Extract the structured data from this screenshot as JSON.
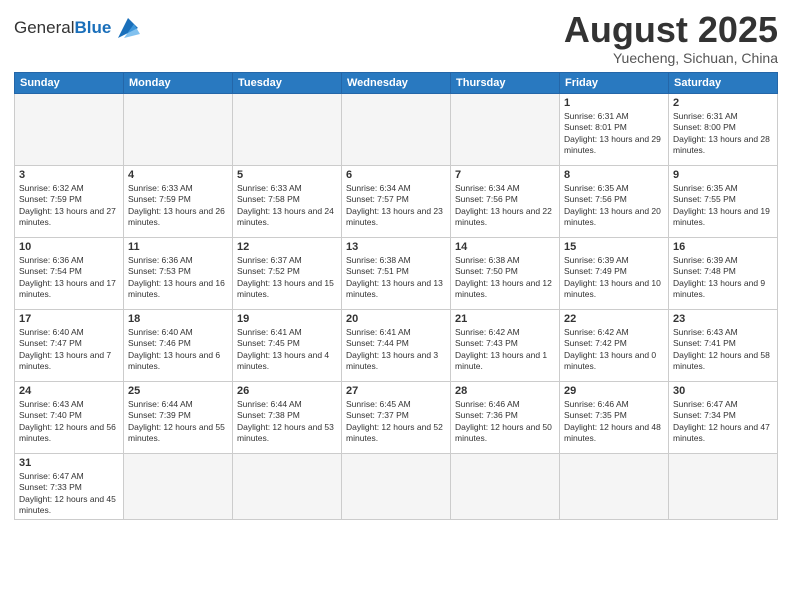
{
  "header": {
    "logo_general": "General",
    "logo_blue": "Blue",
    "month_title": "August 2025",
    "subtitle": "Yuecheng, Sichuan, China"
  },
  "weekdays": [
    "Sunday",
    "Monday",
    "Tuesday",
    "Wednesday",
    "Thursday",
    "Friday",
    "Saturday"
  ],
  "weeks": [
    [
      {
        "day": "",
        "info": ""
      },
      {
        "day": "",
        "info": ""
      },
      {
        "day": "",
        "info": ""
      },
      {
        "day": "",
        "info": ""
      },
      {
        "day": "",
        "info": ""
      },
      {
        "day": "1",
        "info": "Sunrise: 6:31 AM\nSunset: 8:01 PM\nDaylight: 13 hours and 29 minutes."
      },
      {
        "day": "2",
        "info": "Sunrise: 6:31 AM\nSunset: 8:00 PM\nDaylight: 13 hours and 28 minutes."
      }
    ],
    [
      {
        "day": "3",
        "info": "Sunrise: 6:32 AM\nSunset: 7:59 PM\nDaylight: 13 hours and 27 minutes."
      },
      {
        "day": "4",
        "info": "Sunrise: 6:33 AM\nSunset: 7:59 PM\nDaylight: 13 hours and 26 minutes."
      },
      {
        "day": "5",
        "info": "Sunrise: 6:33 AM\nSunset: 7:58 PM\nDaylight: 13 hours and 24 minutes."
      },
      {
        "day": "6",
        "info": "Sunrise: 6:34 AM\nSunset: 7:57 PM\nDaylight: 13 hours and 23 minutes."
      },
      {
        "day": "7",
        "info": "Sunrise: 6:34 AM\nSunset: 7:56 PM\nDaylight: 13 hours and 22 minutes."
      },
      {
        "day": "8",
        "info": "Sunrise: 6:35 AM\nSunset: 7:56 PM\nDaylight: 13 hours and 20 minutes."
      },
      {
        "day": "9",
        "info": "Sunrise: 6:35 AM\nSunset: 7:55 PM\nDaylight: 13 hours and 19 minutes."
      }
    ],
    [
      {
        "day": "10",
        "info": "Sunrise: 6:36 AM\nSunset: 7:54 PM\nDaylight: 13 hours and 17 minutes."
      },
      {
        "day": "11",
        "info": "Sunrise: 6:36 AM\nSunset: 7:53 PM\nDaylight: 13 hours and 16 minutes."
      },
      {
        "day": "12",
        "info": "Sunrise: 6:37 AM\nSunset: 7:52 PM\nDaylight: 13 hours and 15 minutes."
      },
      {
        "day": "13",
        "info": "Sunrise: 6:38 AM\nSunset: 7:51 PM\nDaylight: 13 hours and 13 minutes."
      },
      {
        "day": "14",
        "info": "Sunrise: 6:38 AM\nSunset: 7:50 PM\nDaylight: 13 hours and 12 minutes."
      },
      {
        "day": "15",
        "info": "Sunrise: 6:39 AM\nSunset: 7:49 PM\nDaylight: 13 hours and 10 minutes."
      },
      {
        "day": "16",
        "info": "Sunrise: 6:39 AM\nSunset: 7:48 PM\nDaylight: 13 hours and 9 minutes."
      }
    ],
    [
      {
        "day": "17",
        "info": "Sunrise: 6:40 AM\nSunset: 7:47 PM\nDaylight: 13 hours and 7 minutes."
      },
      {
        "day": "18",
        "info": "Sunrise: 6:40 AM\nSunset: 7:46 PM\nDaylight: 13 hours and 6 minutes."
      },
      {
        "day": "19",
        "info": "Sunrise: 6:41 AM\nSunset: 7:45 PM\nDaylight: 13 hours and 4 minutes."
      },
      {
        "day": "20",
        "info": "Sunrise: 6:41 AM\nSunset: 7:44 PM\nDaylight: 13 hours and 3 minutes."
      },
      {
        "day": "21",
        "info": "Sunrise: 6:42 AM\nSunset: 7:43 PM\nDaylight: 13 hours and 1 minute."
      },
      {
        "day": "22",
        "info": "Sunrise: 6:42 AM\nSunset: 7:42 PM\nDaylight: 13 hours and 0 minutes."
      },
      {
        "day": "23",
        "info": "Sunrise: 6:43 AM\nSunset: 7:41 PM\nDaylight: 12 hours and 58 minutes."
      }
    ],
    [
      {
        "day": "24",
        "info": "Sunrise: 6:43 AM\nSunset: 7:40 PM\nDaylight: 12 hours and 56 minutes."
      },
      {
        "day": "25",
        "info": "Sunrise: 6:44 AM\nSunset: 7:39 PM\nDaylight: 12 hours and 55 minutes."
      },
      {
        "day": "26",
        "info": "Sunrise: 6:44 AM\nSunset: 7:38 PM\nDaylight: 12 hours and 53 minutes."
      },
      {
        "day": "27",
        "info": "Sunrise: 6:45 AM\nSunset: 7:37 PM\nDaylight: 12 hours and 52 minutes."
      },
      {
        "day": "28",
        "info": "Sunrise: 6:46 AM\nSunset: 7:36 PM\nDaylight: 12 hours and 50 minutes."
      },
      {
        "day": "29",
        "info": "Sunrise: 6:46 AM\nSunset: 7:35 PM\nDaylight: 12 hours and 48 minutes."
      },
      {
        "day": "30",
        "info": "Sunrise: 6:47 AM\nSunset: 7:34 PM\nDaylight: 12 hours and 47 minutes."
      }
    ],
    [
      {
        "day": "31",
        "info": "Sunrise: 6:47 AM\nSunset: 7:33 PM\nDaylight: 12 hours and 45 minutes."
      },
      {
        "day": "",
        "info": ""
      },
      {
        "day": "",
        "info": ""
      },
      {
        "day": "",
        "info": ""
      },
      {
        "day": "",
        "info": ""
      },
      {
        "day": "",
        "info": ""
      },
      {
        "day": "",
        "info": ""
      }
    ]
  ]
}
